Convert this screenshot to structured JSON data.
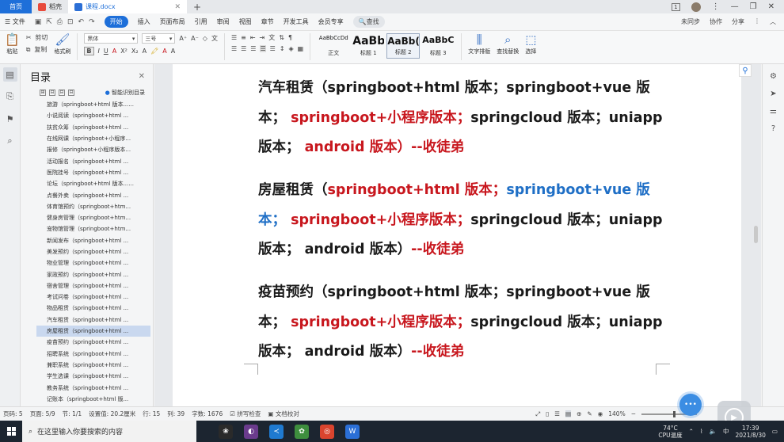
{
  "titlebar": {
    "home_tab": "首页",
    "tabs": [
      {
        "label": "稻壳",
        "icon": "daoke-icon"
      },
      {
        "label": "课程.docx",
        "icon": "word-doc-icon"
      }
    ],
    "new_tab": "+",
    "window_badge": "1"
  },
  "menubar": {
    "file": "文件",
    "items": [
      "开始",
      "插入",
      "页面布局",
      "引用",
      "审阅",
      "视图",
      "章节",
      "开发工具",
      "会员专享"
    ],
    "active": "开始",
    "search": "查找",
    "right": [
      "未同步",
      "协作",
      "分享"
    ]
  },
  "ribbon": {
    "paste": "粘贴",
    "cut": "剪切",
    "copy": "复制",
    "format_painter": "格式刷",
    "font_name": "黑体",
    "font_size": "三号",
    "styles": [
      {
        "preview": "AaBbCcDd",
        "label": "正文"
      },
      {
        "preview": "AaBb",
        "label": "标题 1"
      },
      {
        "preview": "AaBb(",
        "label": "标题 2"
      },
      {
        "preview": "AaBbC",
        "label": "标题 3"
      }
    ],
    "text_layout": "文字排版",
    "find_replace": "查找替换",
    "select": "选择"
  },
  "outline": {
    "title": "目录",
    "smart_label": "智能识别目录",
    "items": [
      "旅游（springboot+html 版本......",
      "小说阅读（springboot+html ...",
      "扶贫众筹（springboot+html ...",
      "在线网课（springboot+小程序...",
      "报修（springboot+小程序版本...",
      "活动报名（springboot+html ...",
      "医院挂号（springboot+html ...",
      "论坛（springboot+html 版本......",
      "点餐外卖（springboot+html ...",
      "体育馆预约（springboot+htm...",
      "健身房管理（springboot+htm...",
      "宠物馆管理（springboot+htm...",
      "新闻发布（springboot+html ...",
      "美发预约（springboot+html ...",
      "物业管理（springboot+html ...",
      "家政预约（springboot+html ...",
      "宿舍管理（springboot+html ...",
      "考试问卷（springboot+html ...",
      "物品租赁（springboot+html ...",
      "汽车租赁（springboot+html ...",
      "房屋租赁（springboot+html ...",
      "疫苗预约（springboot+html ...",
      "招聘系统（springboot+html ...",
      "兼职系统（springboot+html ...",
      "学生选课（springboot+html ...",
      "教务系统（springboot+html ...",
      "记账本（springboot+html 版..."
    ],
    "selected_index": 20
  },
  "document": {
    "p1": {
      "a": "汽车租赁（springboot+html 版本；springboot+vue 版本；",
      "b": "springboot+小程序版本；",
      "c": "springcloud 版本；uniapp 版本；",
      "d": "android 版本）",
      "e": "--收徒弟"
    },
    "p2": {
      "a": "房屋租赁（",
      "b": "springboot+html 版本；",
      "c": "springboot+vue 版本；",
      "d": "springboot+小程序版本；",
      "e": "springcloud 版本；uniapp 版本；",
      "f": "android 版本）",
      "g": "--收徒弟"
    },
    "p3": {
      "a": "疫苗预约（springboot+html 版本；springboot+vue 版本；",
      "b": "springboot+小程序版本；",
      "c": "springcloud 版本；uniapp 版本；",
      "d": "android 版本）",
      "e": "--收徒弟"
    }
  },
  "status": {
    "page_number": "页码: 5",
    "pages": "页面: 5/9",
    "section": "节: 1/1",
    "position": "设置值: 20.2厘米",
    "line": "行: 15",
    "column": "列: 39",
    "words": "字数: 1676",
    "spellcheck": "拼写检查",
    "proofread": "文档校对",
    "zoom": "140%"
  },
  "taskbar": {
    "search_placeholder": "在这里输入你要搜索的内容",
    "weather_temp": "74°C",
    "weather_label": "CPU温度",
    "ime": "中",
    "time": "17:39",
    "date": "2021/8/30"
  },
  "colors": {
    "accent": "#1e6fd9",
    "red_text": "#c8171e",
    "blue_text": "#1f6fc6"
  }
}
